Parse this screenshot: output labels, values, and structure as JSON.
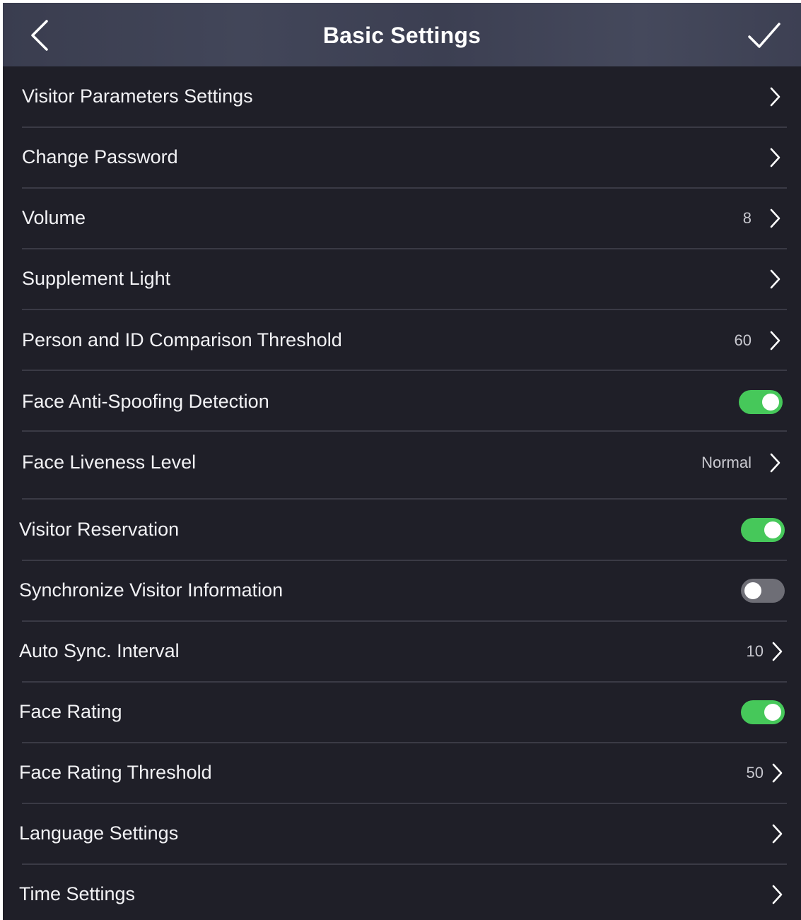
{
  "header": {
    "title": "Basic Settings"
  },
  "settings": [
    {
      "label": "Visitor Parameters Settings",
      "value": "",
      "control": "chevron"
    },
    {
      "label": "Change Password",
      "value": "",
      "control": "chevron"
    },
    {
      "label": "Volume",
      "value": "8",
      "control": "chevron"
    },
    {
      "label": "Supplement Light",
      "value": "",
      "control": "chevron"
    },
    {
      "label": "Person and ID Comparison Threshold",
      "value": "60",
      "control": "chevron"
    },
    {
      "label": "Face Anti-Spoofing Detection",
      "value": "",
      "control": "toggle",
      "enabled": true
    },
    {
      "label": "Face Liveness Level",
      "value": "Normal",
      "control": "chevron"
    },
    {
      "label": "Visitor Reservation",
      "value": "",
      "control": "toggle",
      "enabled": true
    },
    {
      "label": "Synchronize Visitor Information",
      "value": "",
      "control": "toggle",
      "enabled": false
    },
    {
      "label": "Auto Sync. Interval",
      "value": "10",
      "control": "chevron"
    },
    {
      "label": "Face Rating",
      "value": "",
      "control": "toggle",
      "enabled": true
    },
    {
      "label": "Face Rating Threshold",
      "value": "50",
      "control": "chevron"
    },
    {
      "label": "Language Settings",
      "value": "",
      "control": "chevron"
    },
    {
      "label": "Time Settings",
      "value": "",
      "control": "chevron"
    }
  ],
  "icons": {
    "back": "back-arrow-icon",
    "confirm": "checkmark-icon",
    "row_chevron": "chevron-right-icon"
  },
  "colors": {
    "background": "#1f1f28",
    "header": "#3f4255",
    "toggle_on": "#46c85a",
    "toggle_off": "#6e6e76",
    "text": "#f2f2f5"
  }
}
